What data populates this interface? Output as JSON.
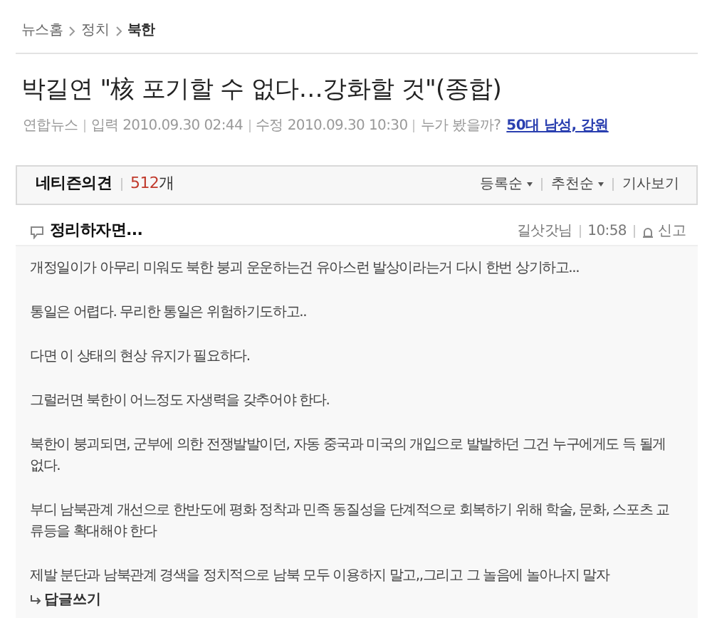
{
  "breadcrumb": [
    {
      "label": "뉴스홈",
      "current": false
    },
    {
      "label": "정치",
      "current": false
    },
    {
      "label": "북한",
      "current": true
    }
  ],
  "article": {
    "title": "박길연 \"核 포기할 수 없다…강화할 것\"(종합)",
    "source": "연합뉴스",
    "input_label": "입력",
    "input_time": "2010.09.30 02:44",
    "edit_label": "수정",
    "edit_time": "2010.09.30 10:30",
    "who_viewed": "누가 봤을까?",
    "who_viewed_link": "50대 남성, 강원"
  },
  "opinions": {
    "title": "네티즌의견",
    "count": "512",
    "count_unit": "개",
    "sort_options": [
      {
        "label": "등록순"
      },
      {
        "label": "추천순"
      }
    ],
    "view_article": "기사보기"
  },
  "comment": {
    "title": "정리하자면...",
    "author": "길삿갓님",
    "time": "10:58",
    "report": "신고",
    "reply": "답글쓰기",
    "paragraphs": [
      "개정일이가 아무리 미워도 북한 붕괴 운운하는건 유아스런 발상이라는거 다시 한번 상기하고...",
      "통일은 어렵다. 무리한 통일은 위험하기도하고..",
      "다면 이 상태의 현상 유지가 필요하다.",
      "그럴러면 북한이 어느정도 자생력을 갖추어야 한다.",
      "북한이 붕괴되면, 군부에 의한 전쟁발발이던, 자동 중국과 미국의 개입으로 발발하던 그건 누구에게도 득 될게 없다.",
      "부디 남북관계 개선으로 한반도에 평화 정착과 민족 동질성을 단계적으로 회복하기 위해 학술, 문화, 스포츠 교류등을 확대해야 한다",
      "제발 분단과 남북관계 경색을 정치적으로 남북 모두 이용하지 말고,,그리고 그 놀음에 놀아나지 말자"
    ]
  }
}
